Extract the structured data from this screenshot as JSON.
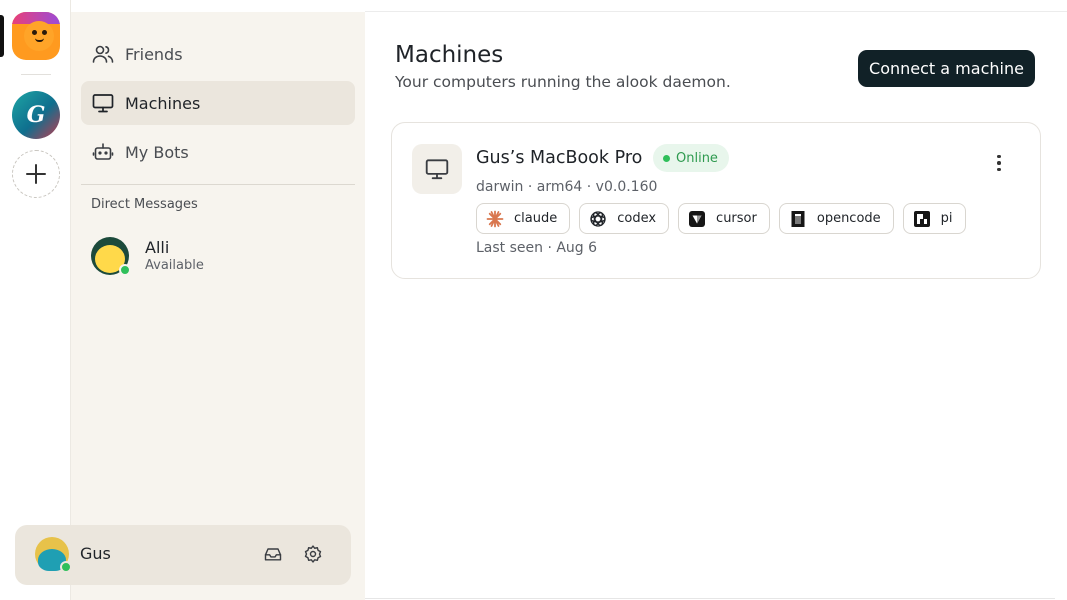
{
  "rail": {
    "servers": [
      {
        "name": "orange-blob-server"
      },
      {
        "name": "g-server",
        "letter": "G"
      }
    ],
    "add_server_icon": "plus-icon"
  },
  "sidebar": {
    "nav": [
      {
        "label": "Friends",
        "icon": "users-icon",
        "active": false
      },
      {
        "label": "Machines",
        "icon": "monitor-icon",
        "active": true
      },
      {
        "label": "My Bots",
        "icon": "bot-icon",
        "active": false
      }
    ],
    "dm_section_title": "Direct Messages",
    "dms": [
      {
        "name": "Alli",
        "status": "Available"
      }
    ]
  },
  "user_bar": {
    "name": "Gus",
    "inbox_icon": "inbox-icon",
    "settings_icon": "gear-icon"
  },
  "main": {
    "title": "Machines",
    "subtitle": "Your computers running the alook daemon.",
    "connect_label": "Connect a machine",
    "machines": [
      {
        "name": "Gus’s MacBook Pro",
        "status": "Online",
        "meta": "darwin · arm64 · v0.0.160",
        "agents": [
          "claude",
          "codex",
          "cursor",
          "opencode",
          "pi"
        ],
        "last_seen": "Last seen · Aug 6"
      }
    ]
  },
  "colors": {
    "accent_dark": "#112127",
    "online_green": "#2fbf5a",
    "sidebar_bg": "#f7f4ee",
    "active_bg": "#ebe6dd"
  }
}
